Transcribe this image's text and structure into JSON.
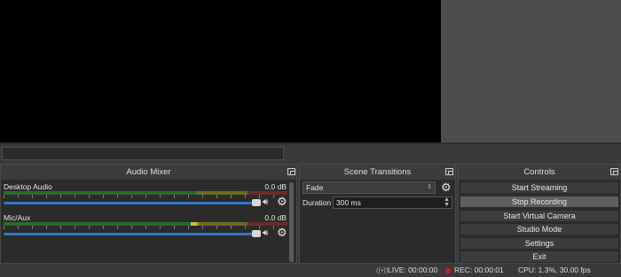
{
  "mixer": {
    "title": "Audio Mixer",
    "channels": [
      {
        "name": "Desktop Audio",
        "db": "0.0 dB"
      },
      {
        "name": "Mic/Aux",
        "db": "0.0 dB"
      }
    ]
  },
  "transitions": {
    "title": "Scene Transitions",
    "selected": "Fade",
    "duration_label": "Duration",
    "duration_value": "300 ms"
  },
  "controls": {
    "title": "Controls",
    "buttons": [
      "Start Streaming",
      "Stop Recording",
      "Start Virtual Camera",
      "Studio Mode",
      "Settings",
      "Exit"
    ]
  },
  "status": {
    "live": "LIVE: 00:00:00",
    "rec": "REC: 00:00:01",
    "cpu": "CPU: 1.3%, 30.00 fps"
  },
  "colors": {
    "rec_dot": "#d21d1d",
    "slider": "#2f74c0"
  }
}
